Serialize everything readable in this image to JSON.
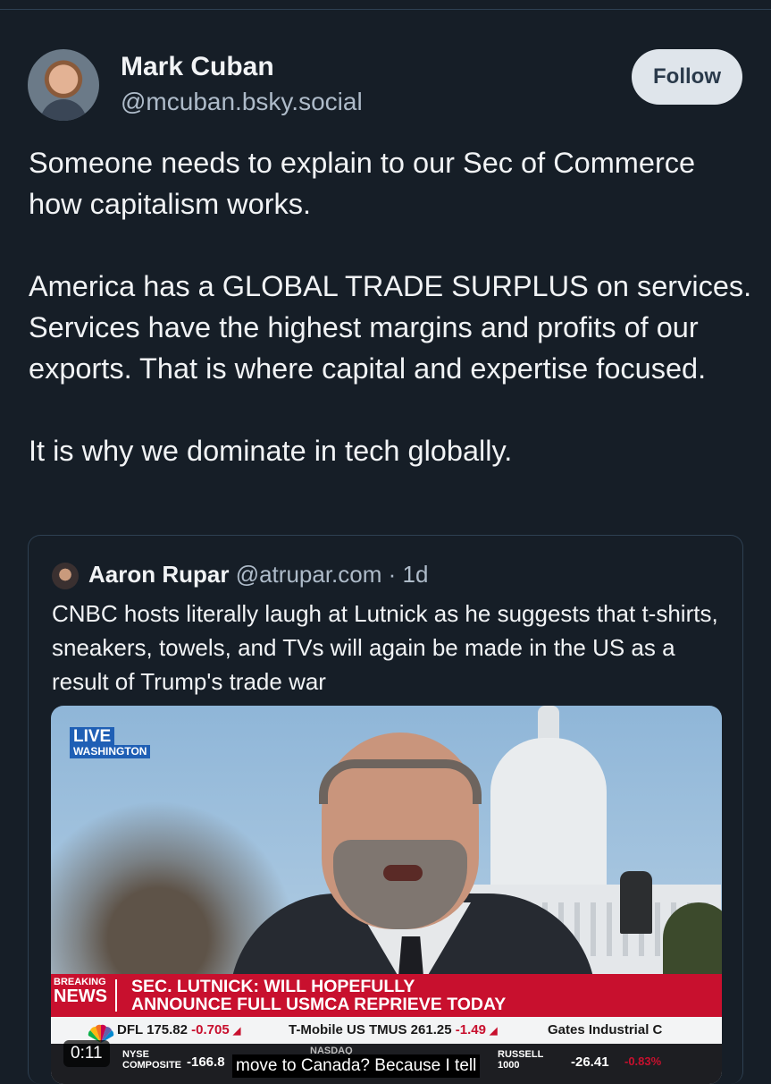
{
  "post": {
    "author_name": "Mark Cuban",
    "author_handle": "@mcuban.bsky.social",
    "follow_label": "Follow",
    "paragraphs": [
      "Someone needs to explain to our Sec of Commerce how capitalism works.",
      "America has a GLOBAL TRADE SURPLUS on services.  Services have the highest margins and profits of our exports. That is where capital and expertise focused.",
      "It is why we dominate in tech globally."
    ]
  },
  "quote": {
    "author_name": "Aaron Rupar",
    "author_handle": "@atrupar.com",
    "separator": "·",
    "age": "1d",
    "text": "CNBC hosts literally laugh at Lutnick as he suggests that t-shirts, sneakers, towels, and TVs will again be made in the US as a result of Trump's trade war"
  },
  "video": {
    "live_label": "LIVE",
    "location_label": "WASHINGTON",
    "breaking_line1": "BREAKING",
    "breaking_line2": "NEWS",
    "headline_line1": "SEC. LUTNICK: WILL HOPEFULLY",
    "headline_line2": "ANNOUNCE FULL USMCA REPRIEVE TODAY",
    "ticker_top": [
      {
        "name": "DFL",
        "value": "175.82",
        "change": "-0.705"
      },
      {
        "name": "T-Mobile US TMUS",
        "value": "261.25",
        "change": "-1.49"
      },
      {
        "name": "Gates Industrial C",
        "value": "",
        "change": ""
      }
    ],
    "ticker_bottom": {
      "nyse_line1": "NYSE",
      "nyse_line2": "COMPOSITE",
      "nyse_change": "-166.8",
      "nasdaq": "NASDAQ",
      "russell_line1": "RUSSELL",
      "russell_line2": "1000",
      "russell_change": "-26.41",
      "russell_pct": "-0.83%"
    },
    "network_logo": "CNBC",
    "timestamp": "0:11",
    "caption": "move to Canada? Because I tell"
  },
  "colors": {
    "background": "#161e27",
    "muted_text": "#aebbc9",
    "border": "#2e4052",
    "breaking_red": "#c8102e"
  },
  "icons": [
    "play-timestamp",
    "nbc-peacock-icon"
  ]
}
